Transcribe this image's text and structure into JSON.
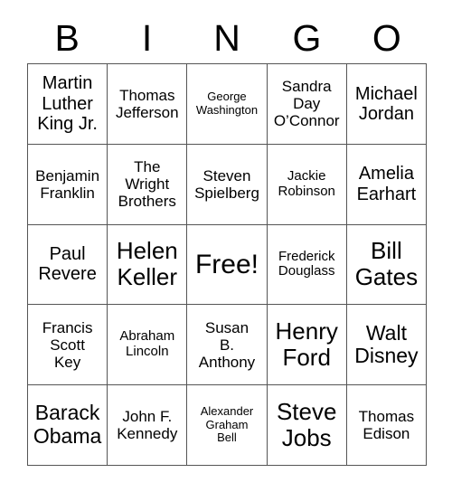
{
  "header": {
    "letters": [
      "B",
      "I",
      "N",
      "G",
      "O"
    ]
  },
  "grid": {
    "rows": [
      [
        {
          "text": "Martin\nLuther\nKing Jr.",
          "size": "lg"
        },
        {
          "text": "Thomas\nJefferson",
          "size": "md"
        },
        {
          "text": "George\nWashington",
          "size": "xs"
        },
        {
          "text": "Sandra\nDay\nO’Connor",
          "size": "md"
        },
        {
          "text": "Michael\nJordan",
          "size": "lg"
        }
      ],
      [
        {
          "text": "Benjamin\nFranklin",
          "size": "md"
        },
        {
          "text": "The\nWright\nBrothers",
          "size": "md"
        },
        {
          "text": "Steven\nSpielberg",
          "size": "md"
        },
        {
          "text": "Jackie\nRobinson",
          "size": "sm"
        },
        {
          "text": "Amelia\nEarhart",
          "size": "lg"
        }
      ],
      [
        {
          "text": "Paul\nRevere",
          "size": "lg"
        },
        {
          "text": "Helen\nKeller",
          "size": "xxl"
        },
        {
          "text": "Free!",
          "size": "free"
        },
        {
          "text": "Frederick\nDouglass",
          "size": "sm"
        },
        {
          "text": "Bill\nGates",
          "size": "xxl"
        }
      ],
      [
        {
          "text": "Francis\nScott\nKey",
          "size": "md"
        },
        {
          "text": "Abraham\nLincoln",
          "size": "sm"
        },
        {
          "text": "Susan\nB.\nAnthony",
          "size": "md"
        },
        {
          "text": "Henry\nFord",
          "size": "xxl"
        },
        {
          "text": "Walt\nDisney",
          "size": "xl"
        }
      ],
      [
        {
          "text": "Barack\nObama",
          "size": "xl"
        },
        {
          "text": "John F.\nKennedy",
          "size": "md"
        },
        {
          "text": "Alexander\nGraham\nBell",
          "size": "xs"
        },
        {
          "text": "Steve\nJobs",
          "size": "xxl"
        },
        {
          "text": "Thomas\nEdison",
          "size": "md"
        }
      ]
    ]
  },
  "colors": {
    "background": "#ffffff",
    "text": "#000000",
    "border": "#555555"
  }
}
